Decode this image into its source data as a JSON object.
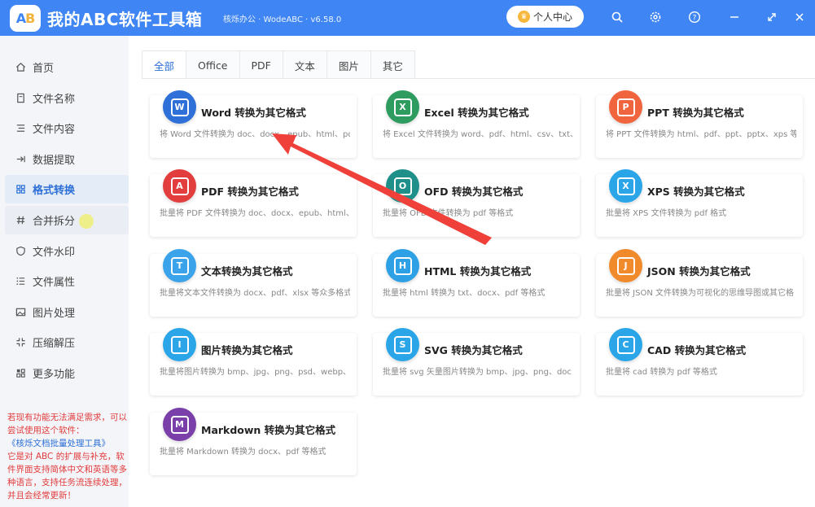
{
  "window": {
    "title": "我的ABC软件工具箱",
    "subtitle": "核烁办公 · WodeABC · v6.58.0",
    "vip_label": "个人中心"
  },
  "sidebar": {
    "items": [
      {
        "label": "首页"
      },
      {
        "label": "文件名称"
      },
      {
        "label": "文件内容"
      },
      {
        "label": "数据提取"
      },
      {
        "label": "格式转换"
      },
      {
        "label": "合并拆分"
      },
      {
        "label": "文件水印"
      },
      {
        "label": "文件属性"
      },
      {
        "label": "图片处理"
      },
      {
        "label": "压缩解压"
      },
      {
        "label": "更多功能"
      }
    ],
    "active_index": 4,
    "note_line1": "若现有功能无法满足需求，可以尝试使用这个软件：",
    "note_link": "《核烁文档批量处理工具》",
    "note_line2": "它是对 ABC 的扩展与补充，软件界面支持简体中文和英语等多种语言，支持任务流连续处理，并且会经常更新！"
  },
  "tabs": [
    {
      "label": "全部",
      "active": true
    },
    {
      "label": "Office"
    },
    {
      "label": "PDF"
    },
    {
      "label": "文本"
    },
    {
      "label": "图片"
    },
    {
      "label": "其它"
    }
  ],
  "cards": [
    {
      "title": "Word 转换为其它格式",
      "desc": "将 Word 文件转换为 doc、docx、epub、html、pd",
      "color": "#2f6fd8",
      "icon": "W"
    },
    {
      "title": "Excel 转换为其它格式",
      "desc": "将 Excel 文件转换为 word、pdf、html、csv、txt、s",
      "color": "#2e9b5f",
      "icon": "X"
    },
    {
      "title": "PPT 转换为其它格式",
      "desc": "将 PPT 文件转换为 html、pdf、ppt、pptx、xps 等",
      "color": "#f0653e",
      "icon": "P"
    },
    {
      "title": "PDF 转换为其它格式",
      "desc": "批量将 PDF 文件转换为 doc、docx、epub、html、",
      "color": "#e23e3e",
      "icon": "A"
    },
    {
      "title": "OFD 转换为其它格式",
      "desc": "批量将 OFD 文件转换为 pdf 等格式",
      "color": "#1f8f8a",
      "icon": "O"
    },
    {
      "title": "XPS 转换为其它格式",
      "desc": "批量将 XPS 文件转换为 pdf 格式",
      "color": "#2aa6e8",
      "icon": "X"
    },
    {
      "title": "文本转换为其它格式",
      "desc": "批量将文本文件转换为 docx、pdf、xlsx 等众多格式",
      "color": "#3aa3ea",
      "icon": "T"
    },
    {
      "title": "HTML 转换为其它格式",
      "desc": "批量将 html 转换为 txt、docx、pdf 等格式",
      "color": "#2ea0e6",
      "icon": "H"
    },
    {
      "title": "JSON 转换为其它格式",
      "desc": "批量将 JSON 文件转换为可视化的思维导图或其它格",
      "color": "#f18a2a",
      "icon": "J"
    },
    {
      "title": "图片转换为其它格式",
      "desc": "批量将图片转换为 bmp、jpg、png、psd、webp、",
      "color": "#2aa6e8",
      "icon": "I"
    },
    {
      "title": "SVG 转换为其它格式",
      "desc": "批量将 svg 矢量图片转换为 bmp、jpg、png、doc",
      "color": "#2aa6e8",
      "icon": "S"
    },
    {
      "title": "CAD 转换为其它格式",
      "desc": "批量将 cad 转换为 pdf 等格式",
      "color": "#2aa6e8",
      "icon": "C"
    },
    {
      "title": "Markdown 转换为其它格式",
      "desc": "批量将 Markdown 转换为 docx、pdf 等格式",
      "color": "#7a3fa8",
      "icon": "M"
    }
  ],
  "colors": {
    "titlebar": "#3f86f4",
    "accent": "#2c6fd6",
    "annotation_arrow": "#f0403a"
  }
}
